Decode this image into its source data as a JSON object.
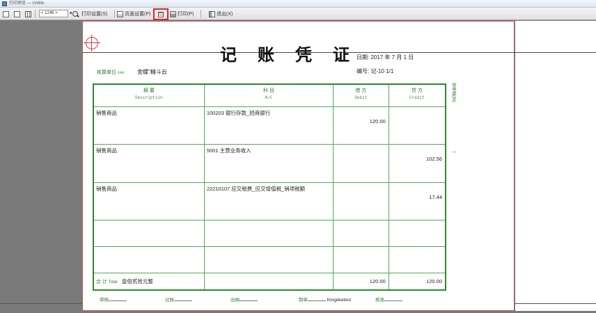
{
  "window": {
    "title": "打印预览 — Untitle"
  },
  "toolbar": {
    "zoom_value": "< 1246 >",
    "print_settings": "打印设置(S)",
    "page_setup": "页面设置(P)",
    "print": "打印(P)",
    "exit": "退出(X)"
  },
  "voucher": {
    "title": "记 账 凭 证",
    "date_text": "日期: 2017 年  7  月  1  日",
    "voucher_no": "编号: 记-10     1/1",
    "unit_label": "核算单位",
    "unit_label_en": "Unit",
    "unit_value": "金蝶\"精斗云",
    "headers": [
      {
        "cn": "摘  要",
        "en": "Description"
      },
      {
        "cn": "科  目",
        "en": "A/C"
      },
      {
        "cn": "借  方",
        "en": "Debit"
      },
      {
        "cn": "贷  方",
        "en": "Credit"
      }
    ],
    "rows": [
      {
        "desc": "销售商品",
        "account": "100203 银行存款_招商银行",
        "debit": "120.00",
        "credit": ""
      },
      {
        "desc": "销售商品",
        "account": "5001 主营业务收入",
        "debit": "",
        "credit": "102.56"
      },
      {
        "desc": "销售商品",
        "account": "22210107 应交税费_应交增值税_销项税额",
        "debit": "",
        "credit": "17.44"
      },
      {
        "desc": "",
        "account": "",
        "debit": "",
        "credit": ""
      },
      {
        "desc": "",
        "account": "",
        "debit": "",
        "credit": ""
      }
    ],
    "total_label": "合 计",
    "total_label_en": "Total",
    "total_words": "壹佰贰拾元整",
    "total_debit": "120.00",
    "total_credit": "120.00",
    "side_text_1": "附单据(张)",
    "side_text_2": "一",
    "footer": [
      {
        "label": "审核"
      },
      {
        "label": "过账"
      },
      {
        "label": "出纳"
      },
      {
        "label": "制单",
        "value": "Kingdeetest"
      },
      {
        "label": "核准"
      }
    ]
  }
}
